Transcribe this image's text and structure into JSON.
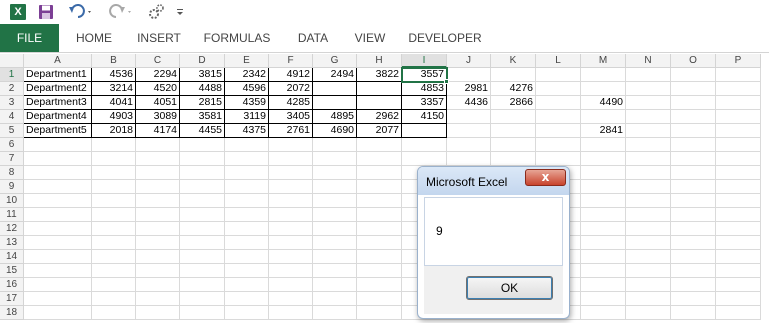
{
  "toolbar": {
    "logo_letter": "X",
    "save_icon": "save-icon",
    "undo_icon": "undo-icon",
    "redo_icon": "redo-icon",
    "macro_icon": "macro-icon",
    "customize_icon": "customize-icon"
  },
  "ribbon": {
    "tabs": [
      {
        "label": "FILE"
      },
      {
        "label": "HOME"
      },
      {
        "label": "INSERT"
      },
      {
        "label": "FORMULAS"
      },
      {
        "label": "DATA"
      },
      {
        "label": "VIEW"
      },
      {
        "label": "DEVELOPER"
      }
    ]
  },
  "sheet": {
    "columns": [
      "A",
      "B",
      "C",
      "D",
      "E",
      "F",
      "G",
      "H",
      "I",
      "J",
      "K",
      "L",
      "M",
      "N",
      "O",
      "P"
    ],
    "rows": [
      "1",
      "2",
      "3",
      "4",
      "5",
      "6",
      "7",
      "8",
      "9",
      "10",
      "11",
      "12",
      "13",
      "14",
      "15",
      "16",
      "17",
      "18"
    ],
    "active_cell": "I1",
    "data": [
      [
        "Department1",
        "4536",
        "2294",
        "3815",
        "2342",
        "4912",
        "2494",
        "3822",
        "3557",
        "",
        "",
        "",
        "",
        "",
        "",
        ""
      ],
      [
        "Department2",
        "3214",
        "4520",
        "4488",
        "4596",
        "2072",
        "",
        "",
        "4853",
        "2981",
        "4276",
        "",
        "",
        "",
        "",
        ""
      ],
      [
        "Department3",
        "4041",
        "4051",
        "2815",
        "4359",
        "4285",
        "",
        "",
        "3357",
        "4436",
        "2866",
        "",
        "4490",
        "",
        "",
        ""
      ],
      [
        "Department4",
        "4903",
        "3089",
        "3581",
        "3119",
        "3405",
        "4895",
        "2962",
        "4150",
        "",
        "",
        "",
        "",
        "",
        "",
        ""
      ],
      [
        "Department5",
        "2018",
        "4174",
        "4455",
        "4375",
        "2761",
        "4690",
        "2077",
        "",
        "",
        "",
        "",
        "2841",
        "",
        "",
        ""
      ]
    ]
  },
  "dialog": {
    "title": "Microsoft Excel",
    "close_label": "x",
    "message": "9",
    "ok_label": "OK"
  },
  "colors": {
    "excel_green": "#217346",
    "header_bg": "#f3f3f3",
    "gridline": "#dadada"
  }
}
